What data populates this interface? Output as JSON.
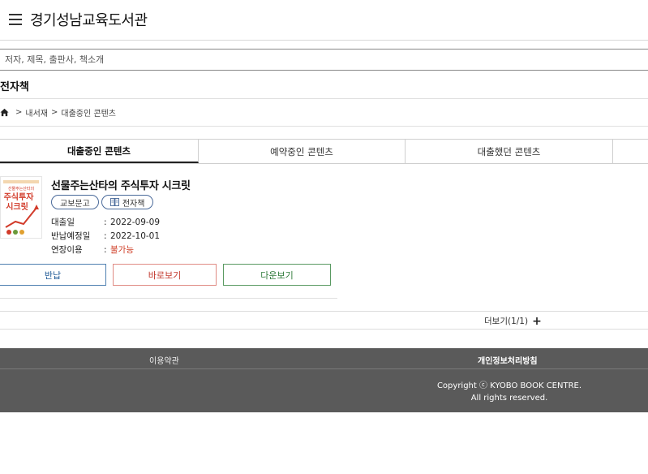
{
  "header": {
    "title": "경기성남교육도서관",
    "menu_icon": "hamburger-menu-icon"
  },
  "search": {
    "placeholder": "저자, 제목, 출판사, 책소개"
  },
  "section": {
    "title": "전자책"
  },
  "breadcrumb": {
    "home_icon": "home-icon",
    "separator": ">",
    "item1": "내서재",
    "item2": "대출중인 콘텐츠"
  },
  "tabs": [
    {
      "label": "대출중인 콘텐츠",
      "active": true
    },
    {
      "label": "예약중인 콘텐츠",
      "active": false
    },
    {
      "label": "대출했던 콘텐츠",
      "active": false
    }
  ],
  "book": {
    "title": "선물주는산타의 주식투자 시크릿",
    "cover_text_top": "선물주는산타의",
    "cover_text_main1": "주식투자",
    "cover_text_main2": "시크릿",
    "badges": {
      "publisher": "교보문고",
      "type": "전자책"
    },
    "fields": [
      {
        "label": "대출일",
        "colon": ":",
        "value": "2022-09-09"
      },
      {
        "label": "반납예정일",
        "colon": ":",
        "value": "2022-10-01"
      },
      {
        "label": "연장이용",
        "colon": ":",
        "value": "불가능"
      }
    ]
  },
  "actions": {
    "return": "반납",
    "view": "바로보기",
    "download": "다운보기"
  },
  "more": {
    "label": "더보기(1/1)",
    "icon": "+"
  },
  "footer": {
    "terms": "이용약관",
    "privacy": "개인정보처리방침",
    "copyright_line1": "Copyright ⓒ KYOBO BOOK CENTRE.",
    "copyright_line2": "All rights reserved."
  },
  "colors": {
    "return": "#1f5a96",
    "view": "#c2392e",
    "download": "#2f7b3a",
    "footer_bg": "#5a5a5a",
    "unavailable": "#d0402a"
  }
}
